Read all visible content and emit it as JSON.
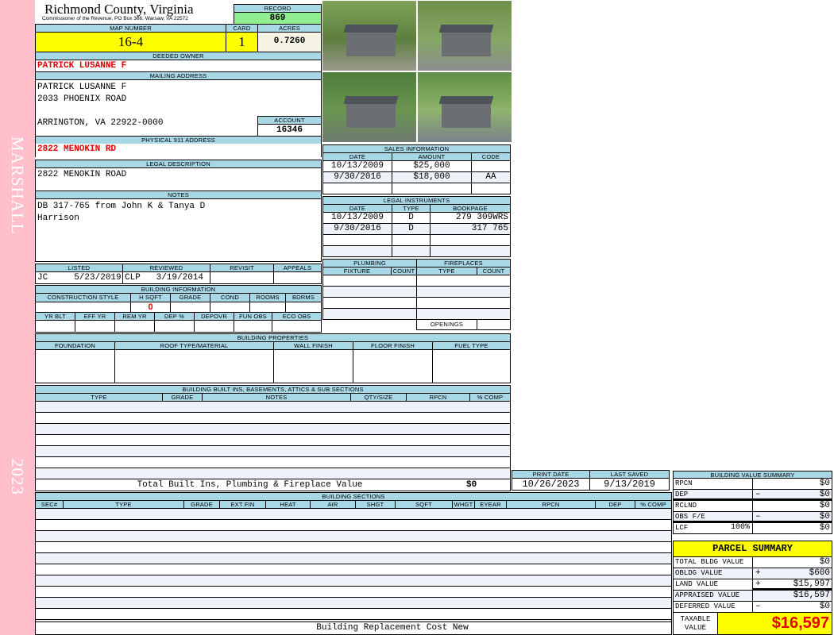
{
  "side": {
    "name": "MARSHALL",
    "year": "2023"
  },
  "header": {
    "county": "Richmond County, Virginia",
    "subtitle": "Commissioner of the Revenue, PO Box 366, Warsaw, VA 22572",
    "record_label": "RECORD",
    "record": "869"
  },
  "parcel": {
    "map_label": "MAP NUMBER",
    "map": "16-4",
    "card_label": "CARD",
    "card": "1",
    "acres_label": "ACRES",
    "acres": "0.7260"
  },
  "owner": {
    "label": "DEEDED OWNER",
    "name": "PATRICK LUSANNE F"
  },
  "mailing": {
    "label": "MAILING ADDRESS",
    "lines": [
      "PATRICK LUSANNE F",
      "2033 PHOENIX ROAD",
      "",
      "ARRINGTON, VA 22922-0000"
    ],
    "account_label": "ACCOUNT",
    "account": "16346"
  },
  "physical": {
    "label": "PHYSICAL 911 ADDRESS",
    "address": "2822 MENOKIN RD"
  },
  "legal": {
    "label": "LEGAL DESCRIPTION",
    "text": "2822 MENOKIN ROAD"
  },
  "notes": {
    "label": "NOTES",
    "lines": [
      "DB 317-765 from John K & Tanya D",
      "Harrison"
    ]
  },
  "review": {
    "headers": [
      "LISTED",
      "REVIEWED",
      "REVISIT",
      "APPEALS"
    ],
    "values": [
      "JC     5/23/2019",
      "CLP   3/19/2014",
      "",
      ""
    ]
  },
  "building_info": {
    "label": "BUILDING INFORMATION",
    "headers1": [
      "CONSTRUCTION STYLE",
      "H SQFT",
      "GRADE",
      "COND",
      "ROOMS",
      "BDRMS"
    ],
    "values1": [
      "",
      "0",
      "",
      "",
      "",
      ""
    ],
    "headers2": [
      "YR BLT",
      "EFF YR",
      "REM YR",
      "DEP %",
      "DEPOVR",
      "FUN OBS",
      "ECO OBS"
    ]
  },
  "sales": {
    "label": "SALES INFORMATION",
    "headers": [
      "DATE",
      "AMOUNT",
      "CODE"
    ],
    "rows": [
      [
        "10/13/2009",
        "$25,000",
        ""
      ],
      [
        "9/30/2016",
        "$18,000",
        "AA"
      ],
      [
        "",
        "",
        ""
      ]
    ]
  },
  "legal_instruments": {
    "label": "LEGAL INSTRUMENTS",
    "headers": [
      "DATE",
      "TYPE",
      "BOOKPAGE"
    ],
    "rows": [
      [
        "10/13/2009",
        "D",
        "279 309WRS"
      ],
      [
        "9/30/2016",
        "D",
        "317 765"
      ],
      [
        "",
        "",
        ""
      ],
      [
        "",
        "",
        ""
      ]
    ]
  },
  "plumbing": {
    "label": "PLUMBING",
    "headers": [
      "FIXTURE",
      "COUNT"
    ]
  },
  "fireplaces": {
    "label": "FIREPLACES",
    "headers": [
      "TYPE",
      "COUNT"
    ],
    "openings_label": "OPENINGS"
  },
  "building_properties": {
    "label": "BUILDING PROPERTIES",
    "headers": [
      "FOUNDATION",
      "ROOF TYPE/MATERIAL",
      "WALL FINISH",
      "FLOOR FINISH",
      "FUEL TYPE"
    ]
  },
  "built_ins": {
    "label": "BUILDING BUILT INS, BASEMENTS, ATTICS & SUB SECTIONS",
    "headers": [
      "TYPE",
      "GRADE",
      "NOTES",
      "QTY/SIZE",
      "RPCN",
      "% COMP"
    ],
    "total_label": "Total Built Ins, Plumbing & Fireplace Value",
    "total": "$0"
  },
  "dates": {
    "print_label": "PRINT DATE",
    "print": "10/26/2023",
    "saved_label": "LAST SAVED",
    "saved": "9/13/2019"
  },
  "sections": {
    "label": "BUILDING SECTIONS",
    "headers": [
      "SEC#",
      "TYPE",
      "GRADE",
      "EXT FIN",
      "HEAT",
      "AIR",
      "SHGT",
      "SQFT",
      "WHGT",
      "EYEAR",
      "RPCN",
      "DEP",
      "% COMP"
    ],
    "footer": "Building Replacement Cost New"
  },
  "value_summary": {
    "label": "BUILDING VALUE SUMMARY",
    "rows": [
      {
        "label": "RPCN",
        "extra": "",
        "sign": "",
        "value": "$0"
      },
      {
        "label": "DEP",
        "extra": "",
        "sign": "–",
        "value": "$0"
      },
      {
        "label": "RCLND",
        "extra": "",
        "sign": "",
        "value": "$0"
      },
      {
        "label": "OBS F/E",
        "extra": "",
        "sign": "–",
        "value": "$0"
      },
      {
        "label": "LCF",
        "extra": "100%",
        "sign": "",
        "value": "$0"
      }
    ]
  },
  "parcel_summary": {
    "label": "PARCEL SUMMARY",
    "rows": [
      {
        "label": "TOTAL BLDG VALUE",
        "sign": "",
        "value": "$0"
      },
      {
        "label": "OBLDG VALUE",
        "sign": "+",
        "value": "$600"
      },
      {
        "label": "LAND VALUE",
        "sign": "+",
        "value": "$15,997"
      },
      {
        "label": "APPRAISED VALUE",
        "sign": "",
        "value": "$16,597"
      },
      {
        "label": "DEFERRED VALUE",
        "sign": "–",
        "value": "$0"
      }
    ],
    "taxable_label": "TAXABLE VALUE",
    "taxable": "$16,597"
  },
  "colors": {
    "header": "#a8d8e6",
    "yellow": "#ffff00",
    "green": "#90ee90",
    "pink": "#ffc0cb",
    "red": "#e00000"
  }
}
